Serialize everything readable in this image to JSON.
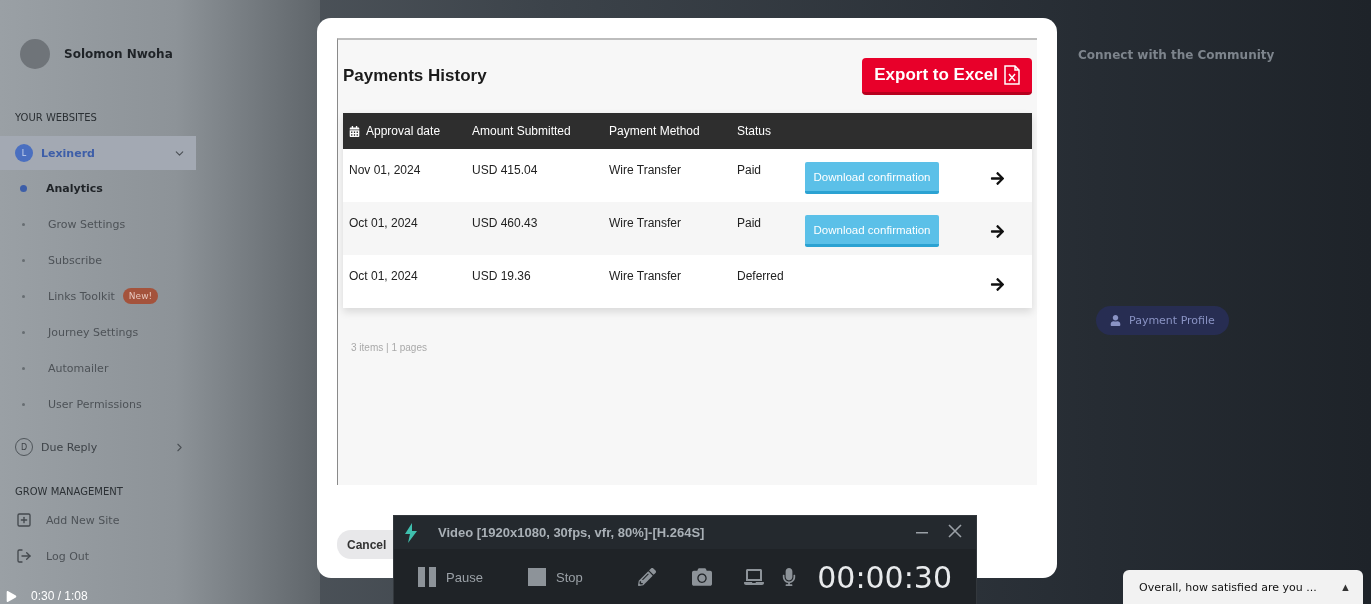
{
  "sidebar": {
    "user_name": "Solomon Nwoha",
    "websites_heading": "YOUR WEBSITES",
    "sites": [
      {
        "initial": "L",
        "name": "Lexinerd",
        "expanded": true,
        "selected": true,
        "items": [
          {
            "label": "Analytics",
            "selected": true
          },
          {
            "label": "Grow Settings",
            "selected": false
          },
          {
            "label": "Subscribe",
            "selected": false
          },
          {
            "label": "Links Toolkit",
            "selected": false,
            "badge": "New!"
          },
          {
            "label": "Journey Settings",
            "selected": false
          },
          {
            "label": "Automailer",
            "selected": false
          },
          {
            "label": "User Permissions",
            "selected": false
          }
        ]
      },
      {
        "initial": "D",
        "name": "Due Reply",
        "expanded": false,
        "selected": false
      }
    ],
    "management_heading": "GROW MANAGEMENT",
    "management_items": [
      {
        "label": "Add New Site",
        "kind": "add"
      },
      {
        "label": "Log Out",
        "kind": "logout"
      }
    ]
  },
  "background": {
    "community_link": "Connect with the Community",
    "payment_profile_button": "Payment Profile"
  },
  "modal": {
    "title": "Payments History",
    "export_button": "Export to Excel",
    "columns": [
      "Approval date",
      "Amount Submitted",
      "Payment Method",
      "Status"
    ],
    "rows": [
      {
        "approval_date": "Nov 01, 2024",
        "amount": "USD 415.04",
        "method": "Wire Transfer",
        "status": "Paid",
        "action": "Download confirmation"
      },
      {
        "approval_date": "Oct 01, 2024",
        "amount": "USD 460.43",
        "method": "Wire Transfer",
        "status": "Paid",
        "action": "Download confirmation"
      },
      {
        "approval_date": "Oct 01, 2024",
        "amount": "USD 19.36",
        "method": "Wire Transfer",
        "status": "Deferred"
      }
    ],
    "footer": "3 items | 1 pages",
    "cancel_button": "Cancel"
  },
  "recorder": {
    "title": "Video [1920x1080, 30fps, vfr, 80%]-[H.264S]",
    "buttons": [
      {
        "label": "Pause",
        "kind": "pause"
      },
      {
        "label": "Stop",
        "kind": "stop"
      }
    ],
    "timer": "00:00:30"
  },
  "player": {
    "time": "0:30 / 1:08",
    "survey": "Overall, how satisfied are you ...",
    "survey_toggle": "▲"
  }
}
